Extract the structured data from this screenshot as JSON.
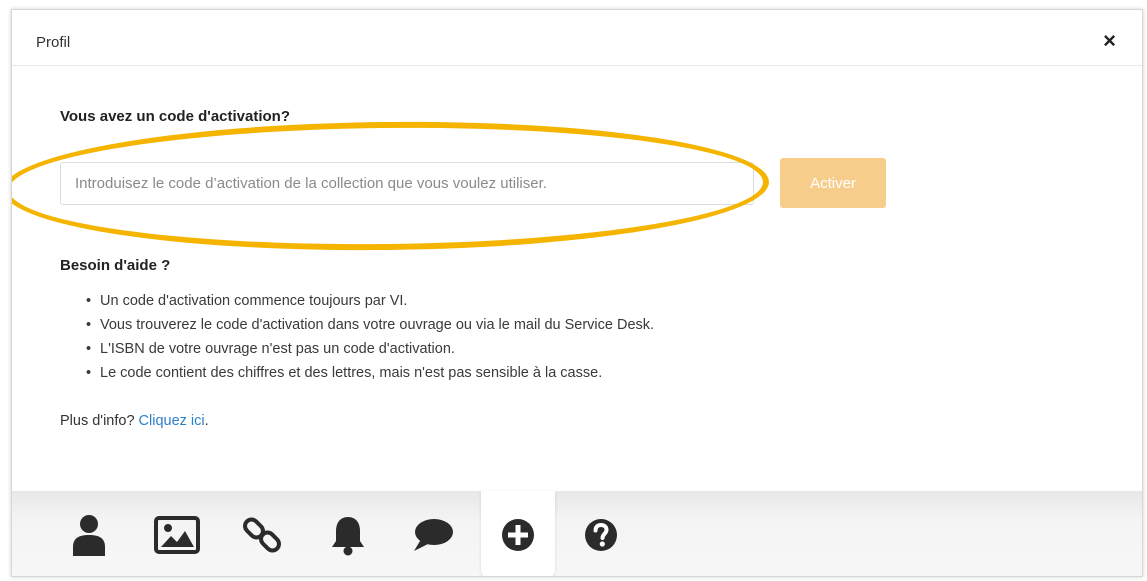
{
  "modal": {
    "title": "Profil",
    "close_label": "×"
  },
  "activation": {
    "heading": "Vous avez un code d'activation?",
    "input_placeholder": "Introduisez le code d’activation de la collection que vous voulez utiliser.",
    "input_value": "",
    "button_label": "Activer"
  },
  "help": {
    "heading": "Besoin d'aide ?",
    "items": [
      "Un code d'activation commence toujours par VI.",
      "Vous trouverez le code d'activation dans votre ouvrage ou via le mail du Service Desk.",
      "L'ISBN de votre ouvrage n'est pas un code d'activation.",
      "Le code contient des chiffres et des lettres, mais n'est pas sensible à la casse."
    ]
  },
  "more_info": {
    "prefix": "Plus d'info? ",
    "link_text": "Cliquez ici",
    "suffix": "."
  },
  "tabs": [
    {
      "icon": "user-icon",
      "active": false
    },
    {
      "icon": "image-icon",
      "active": false
    },
    {
      "icon": "link-icon",
      "active": false
    },
    {
      "icon": "bell-icon",
      "active": false
    },
    {
      "icon": "comment-icon",
      "active": false
    },
    {
      "icon": "plus-circle-icon",
      "active": true
    },
    {
      "icon": "question-circle-icon",
      "active": false
    }
  ],
  "colors": {
    "highlight": "#f4b400",
    "button_bg": "#f7cd8c",
    "link": "#2f7ec9",
    "icon": "#2b2b2b"
  }
}
